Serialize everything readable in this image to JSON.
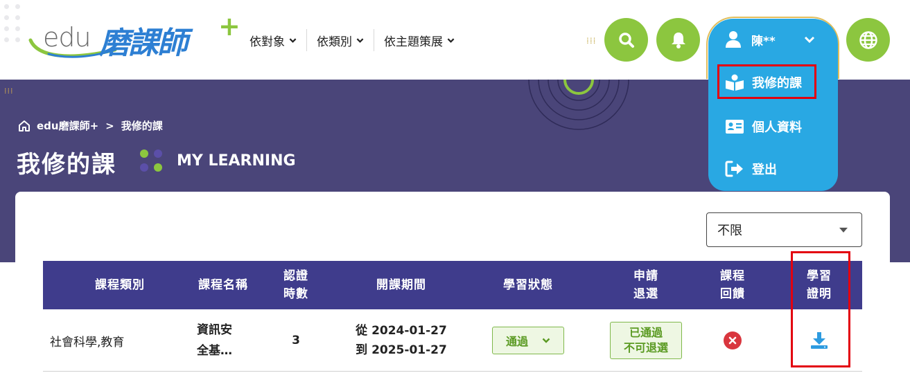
{
  "header": {
    "logo": {
      "edu": "edu",
      "name": "磨課師",
      "plus": "+"
    },
    "nav": [
      {
        "label": "依對象"
      },
      {
        "label": "依類別"
      },
      {
        "label": "依主題策展"
      }
    ],
    "icons": {
      "search": "search-icon",
      "notifications": "bell-icon",
      "language": "globe-icon"
    },
    "user": {
      "name": "陳**",
      "menu": [
        {
          "label": "我修的課",
          "icon": "open-book-icon"
        },
        {
          "label": "個人資料",
          "icon": "id-card-icon"
        },
        {
          "label": "登出",
          "icon": "sign-out-icon"
        }
      ]
    }
  },
  "banner": {
    "breadcrumb": {
      "home": "edu磨課師+",
      "separator": ">",
      "current": "我修的課"
    },
    "title": "我修的課",
    "subtitle": "MY LEARNING"
  },
  "filter": {
    "selected": "不限"
  },
  "table": {
    "headers": {
      "category": "課程類別",
      "name": "課程名稱",
      "hours_l1": "認證",
      "hours_l2": "時數",
      "period": "開課期間",
      "status": "學習狀態",
      "withdraw_l1": "申請",
      "withdraw_l2": "退選",
      "feedback_l1": "課程",
      "feedback_l2": "回饋",
      "cert_l1": "學習",
      "cert_l2": "證明"
    },
    "rows": [
      {
        "category": "社會科學,教育",
        "name_l1": "資訊安",
        "name_l2": "全基…",
        "hours": "3",
        "period_from": "從 2024-01-27",
        "period_to": "到 2025-01-27",
        "status": "通過",
        "withdraw_l1": "已通過",
        "withdraw_l2": "不可退選",
        "feedback_icon": "x-circle-icon",
        "certificate_icon": "download-icon"
      }
    ]
  },
  "colors": {
    "brand_green": "#8cc63f",
    "banner_purple": "#4a4579",
    "table_header": "#3f3c8c",
    "menu_blue": "#29a8e3",
    "highlight_red": "#e3000f"
  }
}
